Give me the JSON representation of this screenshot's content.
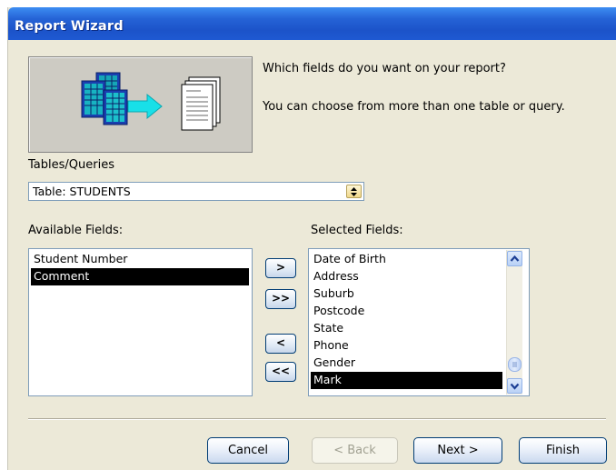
{
  "window": {
    "title": "Report Wizard"
  },
  "intro": {
    "question": "Which fields do you want on your report?",
    "hint": "You can choose from more than one table or query."
  },
  "source": {
    "label": "Tables/Queries",
    "selected": "Table: STUDENTS"
  },
  "available": {
    "label": "Available Fields:",
    "items": [
      "Student Number",
      "Comment"
    ],
    "selected_item": "Comment"
  },
  "selected_fields": {
    "label": "Selected Fields:",
    "items": [
      "Date of Birth",
      "Address",
      "Suburb",
      "Postcode",
      "State",
      "Phone",
      "Gender",
      "Mark"
    ],
    "selected_item": "Mark"
  },
  "move_buttons": {
    "add_one": ">",
    "add_all": ">>",
    "remove_one": "<",
    "remove_all": "<<"
  },
  "footer": {
    "cancel": "Cancel",
    "back": "< Back",
    "next": "Next >",
    "finish": "Finish"
  },
  "icons": {
    "scroll_up": "chevron-up-icon",
    "scroll_down": "chevron-down-icon",
    "spin": "spin-arrows-icon"
  }
}
